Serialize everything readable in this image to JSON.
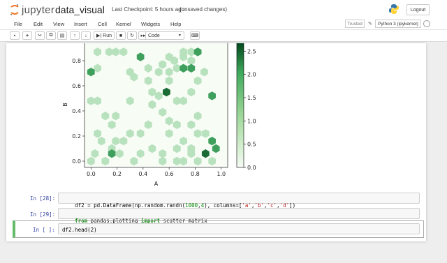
{
  "header": {
    "app_name": "jupyter",
    "notebook_title": "data_visual",
    "checkpoint": "Last Checkpoint: 5 hours ago",
    "unsaved": "(unsaved changes)",
    "logout_label": "Logout"
  },
  "menubar": {
    "items": [
      "File",
      "Edit",
      "View",
      "Insert",
      "Cell",
      "Kernel",
      "Widgets",
      "Help"
    ],
    "trusted_label": "Trusted",
    "kernel_label": "Python 3 (ipykernel)"
  },
  "toolbar": {
    "run_label": "Run",
    "cell_type": "Code"
  },
  "cells": [
    {
      "prompt": "In [28]:",
      "code": "df2 = pd.DataFrame(np.random.randn(1000,4), columns=['a','b','c','d'])"
    },
    {
      "prompt": "In [29]:",
      "code": "from pandas.plotting import scatter_matrix"
    },
    {
      "prompt": "In [ ]:",
      "code": "df2.head(2)"
    }
  ],
  "chart_data": {
    "type": "heatmap",
    "subtype": "hexbin",
    "xlabel": "A",
    "ylabel": "B",
    "xticks": [
      "0.0",
      "0.2",
      "0.4",
      "0.6",
      "0.8",
      "1.0"
    ],
    "yticks": [
      "0.0",
      "0.2",
      "0.4",
      "0.6",
      "0.8"
    ],
    "xlim": [
      -0.05,
      1.05
    ],
    "ylim": [
      -0.05,
      0.95
    ],
    "colorbar_ticks": [
      "0.0",
      "0.5",
      "1.0",
      "1.5",
      "2.0",
      "2.5"
    ],
    "colorbar_range": [
      0,
      2.7
    ],
    "colormap": "Greens",
    "cells": [
      {
        "x": 0.05,
        "y": 0.87,
        "v": 1
      },
      {
        "x": 0.14,
        "y": 0.87,
        "v": 1
      },
      {
        "x": 0.19,
        "y": 0.87,
        "v": 1
      },
      {
        "x": 0.25,
        "y": 0.87,
        "v": 1
      },
      {
        "x": 0.71,
        "y": 0.87,
        "v": 1
      },
      {
        "x": 0.77,
        "y": 0.87,
        "v": 1
      },
      {
        "x": 0.82,
        "y": 0.87,
        "v": 2
      },
      {
        "x": 0.38,
        "y": 0.83,
        "v": 2
      },
      {
        "x": 0.6,
        "y": 0.83,
        "v": 1
      },
      {
        "x": 0.71,
        "y": 0.83,
        "v": 1
      },
      {
        "x": 0.77,
        "y": 0.8,
        "v": 1
      },
      {
        "x": 0.64,
        "y": 0.8,
        "v": 1
      },
      {
        "x": 0.05,
        "y": 0.74,
        "v": 1
      },
      {
        "x": 0.44,
        "y": 0.74,
        "v": 1
      },
      {
        "x": 0.55,
        "y": 0.77,
        "v": 1
      },
      {
        "x": 0.66,
        "y": 0.74,
        "v": 1
      },
      {
        "x": 0.71,
        "y": 0.74,
        "v": 2
      },
      {
        "x": 0.77,
        "y": 0.74,
        "v": 2
      },
      {
        "x": 0.0,
        "y": 0.71,
        "v": 2
      },
      {
        "x": 0.3,
        "y": 0.71,
        "v": 1
      },
      {
        "x": 0.52,
        "y": 0.71,
        "v": 1
      },
      {
        "x": 0.6,
        "y": 0.71,
        "v": 1
      },
      {
        "x": 0.87,
        "y": 0.71,
        "v": 1
      },
      {
        "x": 0.33,
        "y": 0.67,
        "v": 1
      },
      {
        "x": 0.44,
        "y": 0.64,
        "v": 1
      },
      {
        "x": 0.6,
        "y": 0.64,
        "v": 1
      },
      {
        "x": 0.82,
        "y": 0.64,
        "v": 1
      },
      {
        "x": 0.58,
        "y": 0.55,
        "v": 3
      },
      {
        "x": 0.47,
        "y": 0.55,
        "v": 1
      },
      {
        "x": 0.52,
        "y": 0.52,
        "v": 1
      },
      {
        "x": 0.77,
        "y": 0.55,
        "v": 1
      },
      {
        "x": 0.93,
        "y": 0.52,
        "v": 2
      },
      {
        "x": 0.0,
        "y": 0.48,
        "v": 1
      },
      {
        "x": 0.05,
        "y": 0.48,
        "v": 1
      },
      {
        "x": 0.3,
        "y": 0.48,
        "v": 1
      },
      {
        "x": 0.47,
        "y": 0.45,
        "v": 1
      },
      {
        "x": 0.66,
        "y": 0.48,
        "v": 1
      },
      {
        "x": 0.71,
        "y": 0.48,
        "v": 1
      },
      {
        "x": 0.11,
        "y": 0.36,
        "v": 1
      },
      {
        "x": 0.19,
        "y": 0.36,
        "v": 1
      },
      {
        "x": 0.55,
        "y": 0.39,
        "v": 1
      },
      {
        "x": 0.82,
        "y": 0.36,
        "v": 1
      },
      {
        "x": 0.16,
        "y": 0.29,
        "v": 1
      },
      {
        "x": 0.44,
        "y": 0.29,
        "v": 1
      },
      {
        "x": 0.6,
        "y": 0.32,
        "v": 1
      },
      {
        "x": 0.66,
        "y": 0.29,
        "v": 1
      },
      {
        "x": 0.77,
        "y": 0.29,
        "v": 1
      },
      {
        "x": 0.05,
        "y": 0.22,
        "v": 1
      },
      {
        "x": 0.3,
        "y": 0.22,
        "v": 1
      },
      {
        "x": 0.38,
        "y": 0.22,
        "v": 1
      },
      {
        "x": 0.6,
        "y": 0.22,
        "v": 1
      },
      {
        "x": 0.82,
        "y": 0.22,
        "v": 1
      },
      {
        "x": 0.88,
        "y": 0.22,
        "v": 1
      },
      {
        "x": 0.08,
        "y": 0.16,
        "v": 1
      },
      {
        "x": 0.19,
        "y": 0.16,
        "v": 1
      },
      {
        "x": 0.25,
        "y": 0.16,
        "v": 1
      },
      {
        "x": 0.71,
        "y": 0.16,
        "v": 1
      },
      {
        "x": 0.93,
        "y": 0.16,
        "v": 2
      },
      {
        "x": 0.16,
        "y": 0.1,
        "v": 1
      },
      {
        "x": 0.47,
        "y": 0.1,
        "v": 1
      },
      {
        "x": 0.66,
        "y": 0.1,
        "v": 1
      },
      {
        "x": 0.77,
        "y": 0.1,
        "v": 1
      },
      {
        "x": 0.96,
        "y": 0.1,
        "v": 2
      },
      {
        "x": 0.03,
        "y": 0.06,
        "v": 1
      },
      {
        "x": 0.16,
        "y": 0.06,
        "v": 2
      },
      {
        "x": 0.22,
        "y": 0.06,
        "v": 1
      },
      {
        "x": 0.38,
        "y": 0.06,
        "v": 1
      },
      {
        "x": 0.55,
        "y": 0.06,
        "v": 1
      },
      {
        "x": 0.77,
        "y": 0.06,
        "v": 1
      },
      {
        "x": 0.88,
        "y": 0.06,
        "v": 3
      },
      {
        "x": 0.0,
        "y": 0.0,
        "v": 1
      },
      {
        "x": 0.11,
        "y": 0.0,
        "v": 1
      },
      {
        "x": 0.33,
        "y": 0.0,
        "v": 1
      },
      {
        "x": 0.55,
        "y": 0.0,
        "v": 1
      },
      {
        "x": 0.66,
        "y": 0.0,
        "v": 1
      },
      {
        "x": 0.71,
        "y": 0.0,
        "v": 1
      },
      {
        "x": 0.82,
        "y": 0.0,
        "v": 1
      },
      {
        "x": 0.93,
        "y": 0.0,
        "v": 1
      }
    ]
  },
  "colors": {
    "accent": "#f37626",
    "cell_selected_border": "#66bb6a",
    "prompt": "#303f9f"
  }
}
